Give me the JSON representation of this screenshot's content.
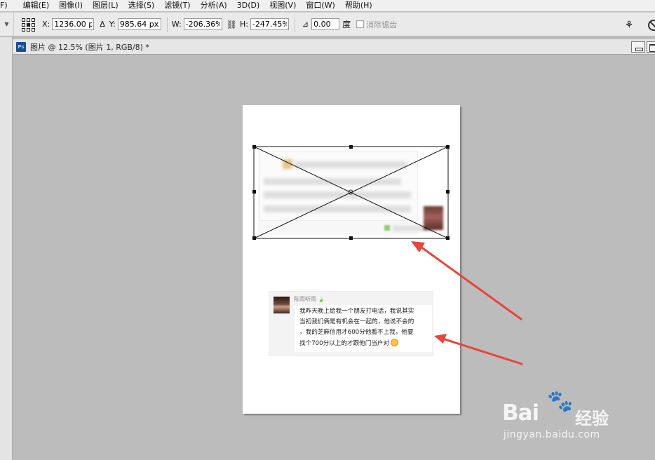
{
  "menubar": {
    "items": [
      {
        "label": "F)"
      },
      {
        "label": "编辑(E)"
      },
      {
        "label": "图像(I)"
      },
      {
        "label": "图层(L)"
      },
      {
        "label": "选择(S)"
      },
      {
        "label": "滤镜(T)"
      },
      {
        "label": "分析(A)"
      },
      {
        "label": "3D(D)"
      },
      {
        "label": "视图(V)"
      },
      {
        "label": "窗口(W)"
      },
      {
        "label": "帮助(H)"
      }
    ]
  },
  "options": {
    "x_label": "X:",
    "x_value": "1236.00 px",
    "delta_icon": "Δ",
    "y_label": "Y:",
    "y_value": "985.64 px",
    "w_label": "W:",
    "w_value": "-206.36%",
    "h_label": "H:",
    "h_value": "-247.45%",
    "angle_value": "0.00",
    "angle_unit": "度",
    "antialias_label": "消除锯齿"
  },
  "document": {
    "ps_badge": "Ps",
    "tab_title": "图片 @ 12.5% (图片 1, RGB/8) *"
  },
  "comment": {
    "username": "陈雨听雨",
    "lines": [
      "我昨天晚上给我一个朋友打电话，我说其实",
      "当初我们俩是有机会在一起的，他说不会的",
      "，我的芝麻信用才600分他看不上我，他要",
      "找个700分以上的才跟他门当户对"
    ]
  },
  "watermark": {
    "brand": "Bai",
    "brand_suffix": "经验",
    "url": "jingyan.baidu.com"
  },
  "colors": {
    "arrow": "#e8453c",
    "ps_blue": "#1b4d8a"
  }
}
